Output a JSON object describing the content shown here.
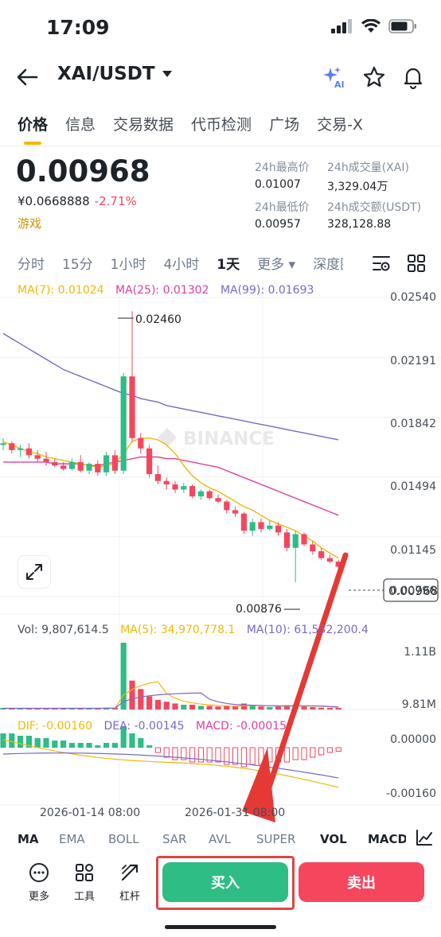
{
  "status_bar": {
    "time": "17:09"
  },
  "header": {
    "pair": "XAI/USDT",
    "ai_label": "AI"
  },
  "tabs": [
    {
      "label": "价格",
      "active": true
    },
    {
      "label": "信息"
    },
    {
      "label": "交易数据"
    },
    {
      "label": "代币检测"
    },
    {
      "label": "广场"
    },
    {
      "label": "交易-X"
    }
  ],
  "price": {
    "last": "0.00968",
    "cny": "¥0.0668888",
    "change": "-2.71%",
    "category": "游戏"
  },
  "stats": {
    "high_label": "24h最高价",
    "high": "0.01007",
    "low_label": "24h最低价",
    "low": "0.00957",
    "vol_base_label": "24h成交量(XAI)",
    "vol_base": "3,329.04万",
    "vol_quote_label": "24h成交额(USDT)",
    "vol_quote": "328,128.88"
  },
  "intervals": [
    {
      "label": "分时"
    },
    {
      "label": "15分"
    },
    {
      "label": "1小时"
    },
    {
      "label": "4小时"
    },
    {
      "label": "1天",
      "active": true
    },
    {
      "label": "更多 ▾"
    },
    {
      "label": "深度图"
    }
  ],
  "chart": {
    "ma_legend": {
      "ma7": "MA(7): 0.01024",
      "ma25": "MA(25): 0.01302",
      "ma99": "MA(99): 0.01693"
    },
    "y_axis": [
      "0.02540",
      "0.02191",
      "0.01842",
      "0.01494",
      "0.01145",
      "0.00796"
    ],
    "high_marker": "0.02460",
    "low_marker": "0.00876",
    "current_price_tag": "0.00968",
    "watermark": "BINANCE",
    "vol_legend": {
      "vol": "Vol: 9,807,614.5",
      "ma5": "MA(5): 34,970,778.1",
      "ma10": "MA(10): 61,532,200.4"
    },
    "vol_axis": [
      "1.11B",
      "9.81M"
    ],
    "macd_legend": {
      "dif": "DIF: -0.00160",
      "dea": "DEA: -0.00145",
      "macd": "MACD: -0.00015"
    },
    "macd_axis": [
      "0.00000",
      "-0.00160"
    ],
    "x_axis": [
      "2026-01-14 08:00",
      "2026-01-31 08:00"
    ],
    "colors": {
      "up": "#2ebd85",
      "down": "#f6465d",
      "ma7": "#f0b90b",
      "ma25": "#e040a0",
      "ma99": "#7b68c8"
    }
  },
  "chart_data": {
    "type": "candlestick",
    "ylim": [
      0.00796,
      0.0254
    ],
    "price_axis_ticks": [
      0.0254,
      0.02191,
      0.01842,
      0.01494,
      0.01145,
      0.00796
    ],
    "candles_ohlc": [
      [
        0.0168,
        0.0172,
        0.0165,
        0.0169
      ],
      [
        0.0169,
        0.017,
        0.0163,
        0.0165
      ],
      [
        0.0165,
        0.0168,
        0.0161,
        0.0166
      ],
      [
        0.0166,
        0.0169,
        0.016,
        0.0162
      ],
      [
        0.0162,
        0.0165,
        0.0158,
        0.016
      ],
      [
        0.016,
        0.0164,
        0.0156,
        0.0158
      ],
      [
        0.0158,
        0.016,
        0.0155,
        0.0156
      ],
      [
        0.0156,
        0.0158,
        0.0153,
        0.0154
      ],
      [
        0.0154,
        0.016,
        0.0153,
        0.0158
      ],
      [
        0.0158,
        0.0162,
        0.0152,
        0.0153
      ],
      [
        0.0153,
        0.0158,
        0.0151,
        0.0157
      ],
      [
        0.0157,
        0.0159,
        0.015,
        0.0152
      ],
      [
        0.0152,
        0.0164,
        0.015,
        0.0162
      ],
      [
        0.0162,
        0.0165,
        0.0151,
        0.0153
      ],
      [
        0.0153,
        0.021,
        0.0151,
        0.0208
      ],
      [
        0.0208,
        0.0246,
        0.017,
        0.0172
      ],
      [
        0.0172,
        0.0175,
        0.0163,
        0.0166
      ],
      [
        0.0166,
        0.0168,
        0.0149,
        0.0151
      ],
      [
        0.0151,
        0.0156,
        0.0145,
        0.0147
      ],
      [
        0.0147,
        0.0149,
        0.0142,
        0.0145
      ],
      [
        0.0145,
        0.0147,
        0.014,
        0.0142
      ],
      [
        0.0142,
        0.0146,
        0.014,
        0.0144
      ],
      [
        0.0144,
        0.0145,
        0.0137,
        0.0138
      ],
      [
        0.0138,
        0.0142,
        0.0136,
        0.0141
      ],
      [
        0.0141,
        0.0142,
        0.0136,
        0.0137
      ],
      [
        0.0137,
        0.0139,
        0.0134,
        0.0135
      ],
      [
        0.0135,
        0.0136,
        0.0128,
        0.013
      ],
      [
        0.013,
        0.0132,
        0.0126,
        0.0128
      ],
      [
        0.0128,
        0.0129,
        0.0116,
        0.0118
      ],
      [
        0.0118,
        0.0125,
        0.0115,
        0.0123
      ],
      [
        0.0123,
        0.0125,
        0.0117,
        0.0119
      ],
      [
        0.0119,
        0.0124,
        0.0118,
        0.0121
      ],
      [
        0.0121,
        0.0123,
        0.0115,
        0.0117
      ],
      [
        0.0117,
        0.0119,
        0.0106,
        0.0108
      ],
      [
        0.0108,
        0.0118,
        0.0088,
        0.0116
      ],
      [
        0.0116,
        0.0117,
        0.0109,
        0.011
      ],
      [
        0.011,
        0.0112,
        0.0104,
        0.0106
      ],
      [
        0.0106,
        0.0108,
        0.0101,
        0.0102
      ],
      [
        0.0102,
        0.0104,
        0.0099,
        0.01
      ],
      [
        0.01,
        0.0101,
        0.0096,
        0.0097
      ]
    ],
    "series": [
      {
        "name": "MA(7)",
        "values": [
          0.017,
          0.0168,
          0.0166,
          0.0164,
          0.0163,
          0.0161,
          0.016,
          0.0159,
          0.0158,
          0.0157,
          0.0156,
          0.0155,
          0.0156,
          0.0157,
          0.0163,
          0.017,
          0.0172,
          0.0172,
          0.0171,
          0.0168,
          0.0163,
          0.0156,
          0.015,
          0.0146,
          0.0143,
          0.0141,
          0.0138,
          0.0135,
          0.0132,
          0.013,
          0.0127,
          0.0124,
          0.0122,
          0.012,
          0.0118,
          0.0115,
          0.0112,
          0.0108,
          0.0105,
          0.0102
        ]
      },
      {
        "name": "MA(25)",
        "values": [
          0.0158,
          0.0158,
          0.0158,
          0.0158,
          0.0158,
          0.0158,
          0.0157,
          0.0157,
          0.0157,
          0.0157,
          0.0156,
          0.0156,
          0.0157,
          0.0158,
          0.0159,
          0.016,
          0.0161,
          0.0161,
          0.0161,
          0.016,
          0.016,
          0.0159,
          0.0158,
          0.0157,
          0.0156,
          0.0155,
          0.0153,
          0.0151,
          0.0149,
          0.0147,
          0.0145,
          0.0143,
          0.0141,
          0.0139,
          0.0137,
          0.0135,
          0.0133,
          0.0131,
          0.0129,
          0.0127
        ]
      },
      {
        "name": "MA(99)",
        "values": [
          0.0233,
          0.023,
          0.0227,
          0.0224,
          0.0221,
          0.0218,
          0.0215,
          0.0212,
          0.021,
          0.0208,
          0.0206,
          0.0204,
          0.0202,
          0.02,
          0.0198,
          0.0197,
          0.0195,
          0.0194,
          0.0193,
          0.0191,
          0.019,
          0.0189,
          0.0188,
          0.0187,
          0.0186,
          0.0185,
          0.0184,
          0.0183,
          0.0182,
          0.0181,
          0.018,
          0.0179,
          0.0178,
          0.0177,
          0.0176,
          0.0175,
          0.0174,
          0.0173,
          0.0172,
          0.0171
        ]
      }
    ],
    "volume": [
      0.02,
      0.02,
      0.02,
      0.02,
      0.02,
      0.02,
      0.02,
      0.02,
      0.02,
      0.02,
      0.02,
      0.02,
      0.03,
      0.03,
      1.11,
      0.48,
      0.34,
      0.22,
      0.16,
      0.13,
      0.1,
      0.08,
      0.08,
      0.06,
      0.06,
      0.05,
      0.06,
      0.05,
      0.1,
      0.07,
      0.05,
      0.04,
      0.05,
      0.07,
      0.08,
      0.05,
      0.04,
      0.03,
      0.02,
      0.01
    ],
    "macd_hist": [
      0.0006,
      0.0006,
      0.0005,
      0.0005,
      0.0004,
      0.0004,
      0.0003,
      0.0003,
      0.0002,
      0.0002,
      0.0002,
      0.0001,
      0.0002,
      0.0002,
      0.0009,
      0.0006,
      0.0004,
      0.0001,
      -0.0002,
      -0.0004,
      -0.0005,
      -0.0005,
      -0.0006,
      -0.0006,
      -0.0006,
      -0.0006,
      -0.0007,
      -0.0007,
      -0.0008,
      -0.0007,
      -0.0007,
      -0.0006,
      -0.0006,
      -0.0006,
      -0.0005,
      -0.0005,
      -0.0004,
      -0.0003,
      -0.0002,
      -0.00015
    ]
  },
  "indicators": [
    {
      "label": "MA",
      "active": true
    },
    {
      "label": "EMA"
    },
    {
      "label": "BOLL"
    },
    {
      "label": "SAR"
    },
    {
      "label": "AVL"
    },
    {
      "label": "SUPER"
    },
    {
      "label": "VOL",
      "active": true
    },
    {
      "label": "MACD",
      "active": true
    }
  ],
  "bottom": {
    "more": "更多",
    "tools": "工具",
    "leverage": "杠杆",
    "buy": "买入",
    "sell": "卖出"
  }
}
